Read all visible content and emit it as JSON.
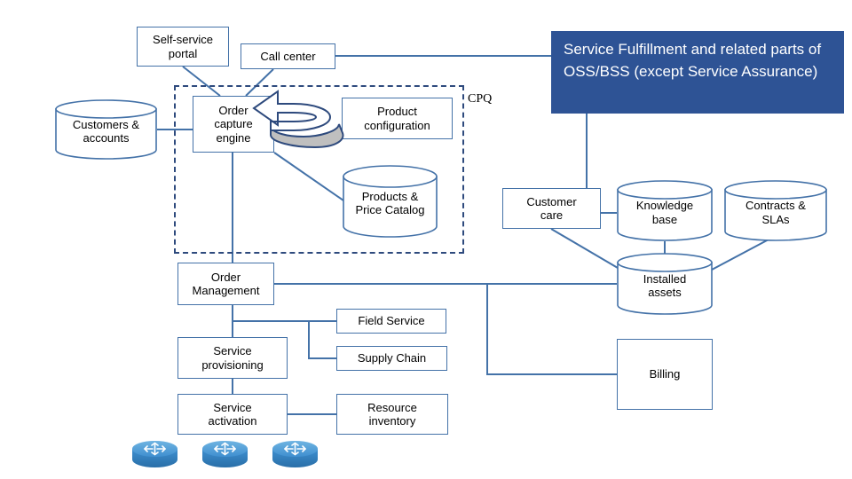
{
  "diagram": {
    "title_banner": {
      "text": "Service Fulfillment and related parts of OSS/BSS (except Service Assurance)",
      "color": "#2e5395",
      "text_color": "#ffffff"
    },
    "group_label": "CPQ",
    "colors": {
      "line": "#4472a8",
      "dashed_border": "#2e4a7d",
      "box_border": "#4472a8",
      "banner": "#2e5395",
      "router_blue": "#3f8fd0",
      "arrow_fill": "#ffffff",
      "arrow_shadow": "#bfbfbf",
      "background": "#ffffff"
    },
    "nodes": [
      {
        "id": "self-service-portal",
        "shape": "box",
        "lines": [
          "Self-service",
          "portal"
        ]
      },
      {
        "id": "call-center",
        "shape": "box",
        "lines": [
          "Call center"
        ]
      },
      {
        "id": "customers-accounts",
        "shape": "cylinder",
        "lines": [
          "Customers &",
          "accounts"
        ]
      },
      {
        "id": "order-capture-engine",
        "shape": "box",
        "lines": [
          "Order",
          "capture",
          "engine"
        ]
      },
      {
        "id": "product-configuration",
        "shape": "box",
        "lines": [
          "Product",
          "configuration"
        ]
      },
      {
        "id": "products-price-catalog",
        "shape": "cylinder",
        "lines": [
          "Products &",
          "Price Catalog"
        ]
      },
      {
        "id": "order-management",
        "shape": "box",
        "lines": [
          "Order",
          "Management"
        ]
      },
      {
        "id": "field-service",
        "shape": "box",
        "lines": [
          "Field Service"
        ]
      },
      {
        "id": "service-provisioning",
        "shape": "box",
        "lines": [
          "Service",
          "provisioning"
        ]
      },
      {
        "id": "supply-chain",
        "shape": "box",
        "lines": [
          "Supply Chain"
        ]
      },
      {
        "id": "service-activation",
        "shape": "box",
        "lines": [
          "Service",
          "activation"
        ]
      },
      {
        "id": "resource-inventory",
        "shape": "box",
        "lines": [
          "Resource",
          "inventory"
        ]
      },
      {
        "id": "customer-care",
        "shape": "box",
        "lines": [
          "Customer",
          "care"
        ]
      },
      {
        "id": "knowledge-base",
        "shape": "cylinder",
        "lines": [
          "Knowledge",
          "base"
        ]
      },
      {
        "id": "contracts-slas",
        "shape": "cylinder",
        "lines": [
          "Contracts &",
          "SLAs"
        ]
      },
      {
        "id": "installed-assets",
        "shape": "cylinder",
        "lines": [
          "Installed",
          "assets"
        ]
      },
      {
        "id": "billing",
        "shape": "box",
        "lines": [
          "Billing"
        ]
      }
    ],
    "routers": [
      {
        "id": "router-1"
      },
      {
        "id": "router-2"
      },
      {
        "id": "router-3"
      }
    ]
  }
}
